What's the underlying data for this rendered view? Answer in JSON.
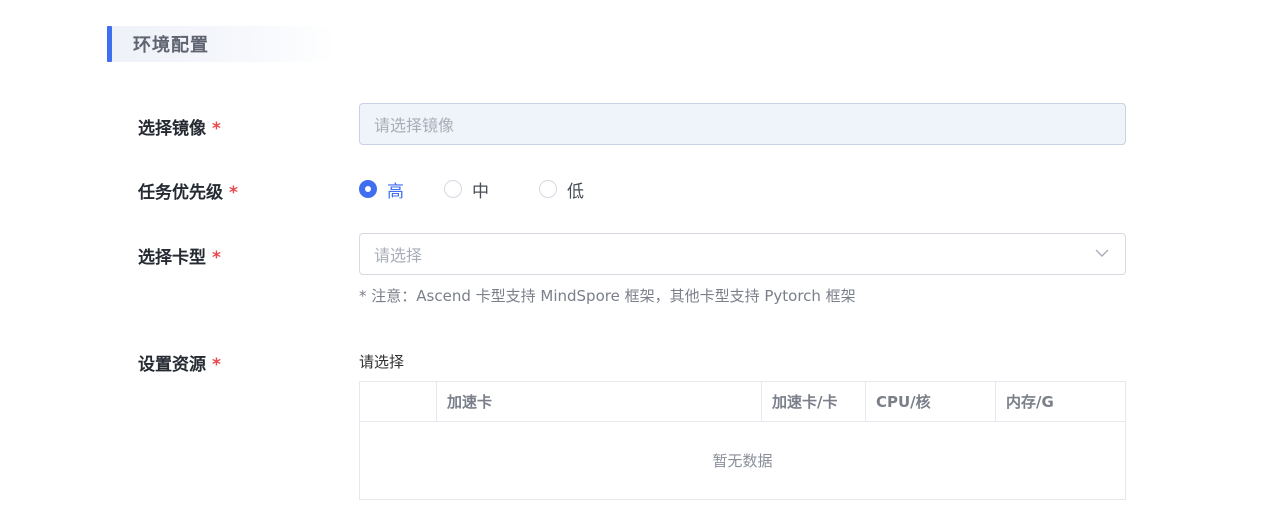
{
  "section": {
    "title": "环境配置"
  },
  "form": {
    "image": {
      "label": "选择镜像",
      "required_mark": "*",
      "placeholder": "请选择镜像"
    },
    "priority": {
      "label": "任务优先级",
      "required_mark": "*",
      "options": [
        {
          "label": "高",
          "checked": true
        },
        {
          "label": "中",
          "checked": false
        },
        {
          "label": "低",
          "checked": false
        }
      ]
    },
    "card_type": {
      "label": "选择卡型",
      "required_mark": "*",
      "placeholder": "请选择",
      "note": "* 注意：Ascend 卡型支持 MindSpore 框架，其他卡型支持 Pytorch 框架"
    },
    "resources": {
      "label": "设置资源",
      "required_mark": "*",
      "sublabel": "请选择",
      "columns": [
        "",
        "加速卡",
        "加速卡/卡",
        "CPU/核",
        "内存/G"
      ],
      "empty_text": "暂无数据"
    }
  },
  "colors": {
    "accent": "#3f6ff0",
    "required": "#e5484d"
  },
  "icons": {
    "select_arrow": "chevron-down-icon",
    "section_marker": "section-bar"
  }
}
